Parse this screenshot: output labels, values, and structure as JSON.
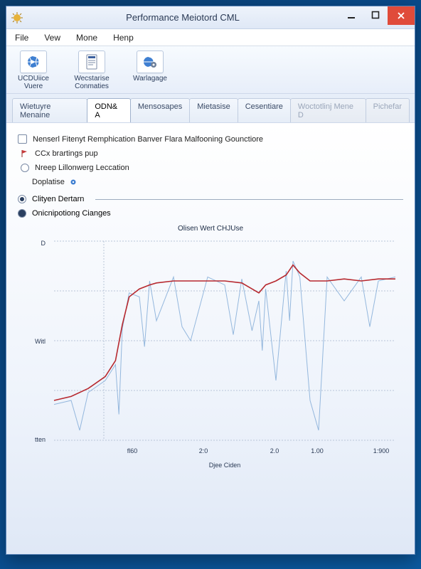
{
  "window": {
    "title": "Performance Meiotord CML",
    "icon_name": "gear-star-icon"
  },
  "menubar": [
    "File",
    "Vew",
    "Mone",
    "Henp"
  ],
  "toolbar": [
    {
      "icon": "globe-arrow-icon",
      "label": "UCDUiice\nVuere"
    },
    {
      "icon": "document-lines-icon",
      "label": "Wecstarise\nConmaties"
    },
    {
      "icon": "globe-cog-icon",
      "label": "Warlagage"
    }
  ],
  "tabs": [
    {
      "label": "Wietuyre Menaine",
      "active": false,
      "disabled": false
    },
    {
      "label": "ODN& A",
      "active": true,
      "disabled": false
    },
    {
      "label": "Mensosapes",
      "active": false,
      "disabled": false
    },
    {
      "label": "Mietasise",
      "active": false,
      "disabled": false
    },
    {
      "label": "Cesentiare",
      "active": false,
      "disabled": false
    },
    {
      "label": "Woctotlinj Mene D",
      "active": false,
      "disabled": true
    },
    {
      "label": "Pichefar",
      "active": false,
      "disabled": true
    }
  ],
  "options": {
    "check1_label": "Nenserl Fitenyt Remphication Banver Flara Malfooning Gounctiore",
    "radio1_label": "CCx brartings pup",
    "radio1_icon": "red-flag-icon",
    "radio2_label": "Nreep Lillonwerg Leccation",
    "plain_label": "Doplatise",
    "plain_icon": "blue-dot-icon",
    "section1_label": "Clityen Dertarn",
    "section2_label": "Onicnipotiong Cianges"
  },
  "chart_data": {
    "type": "line",
    "title": "Olisen Wert CHJUse",
    "xlabel": "Djee Ciden",
    "ylabel": "",
    "y_ticks": [
      "D",
      "Witl",
      "tten"
    ],
    "x_ticks": [
      "fl60",
      "2:0",
      "2.0",
      "1.00",
      "1:900"
    ],
    "x": [
      0,
      5,
      10,
      15,
      18,
      20,
      22,
      25,
      28,
      30,
      35,
      40,
      45,
      50,
      55,
      58,
      60,
      62,
      65,
      68,
      70,
      72,
      75,
      80,
      85,
      90,
      95,
      100
    ],
    "series": [
      {
        "name": "main",
        "color": "#b7292f",
        "values": [
          20,
          22,
          26,
          32,
          40,
          58,
          72,
          76,
          78,
          79,
          80,
          80,
          80,
          80,
          79,
          76,
          74,
          78,
          80,
          83,
          88,
          84,
          80,
          80,
          81,
          80,
          81,
          81
        ]
      },
      {
        "name": "background",
        "color": "#8ab0d9",
        "values": [
          18,
          20,
          24,
          30,
          38,
          56,
          74,
          72,
          80,
          60,
          82,
          50,
          82,
          78,
          81,
          55,
          70,
          76,
          30,
          85,
          90,
          82,
          20,
          82,
          70,
          82,
          80,
          82
        ]
      }
    ],
    "ylim": [
      0,
      100
    ],
    "xlim": [
      0,
      100
    ]
  }
}
